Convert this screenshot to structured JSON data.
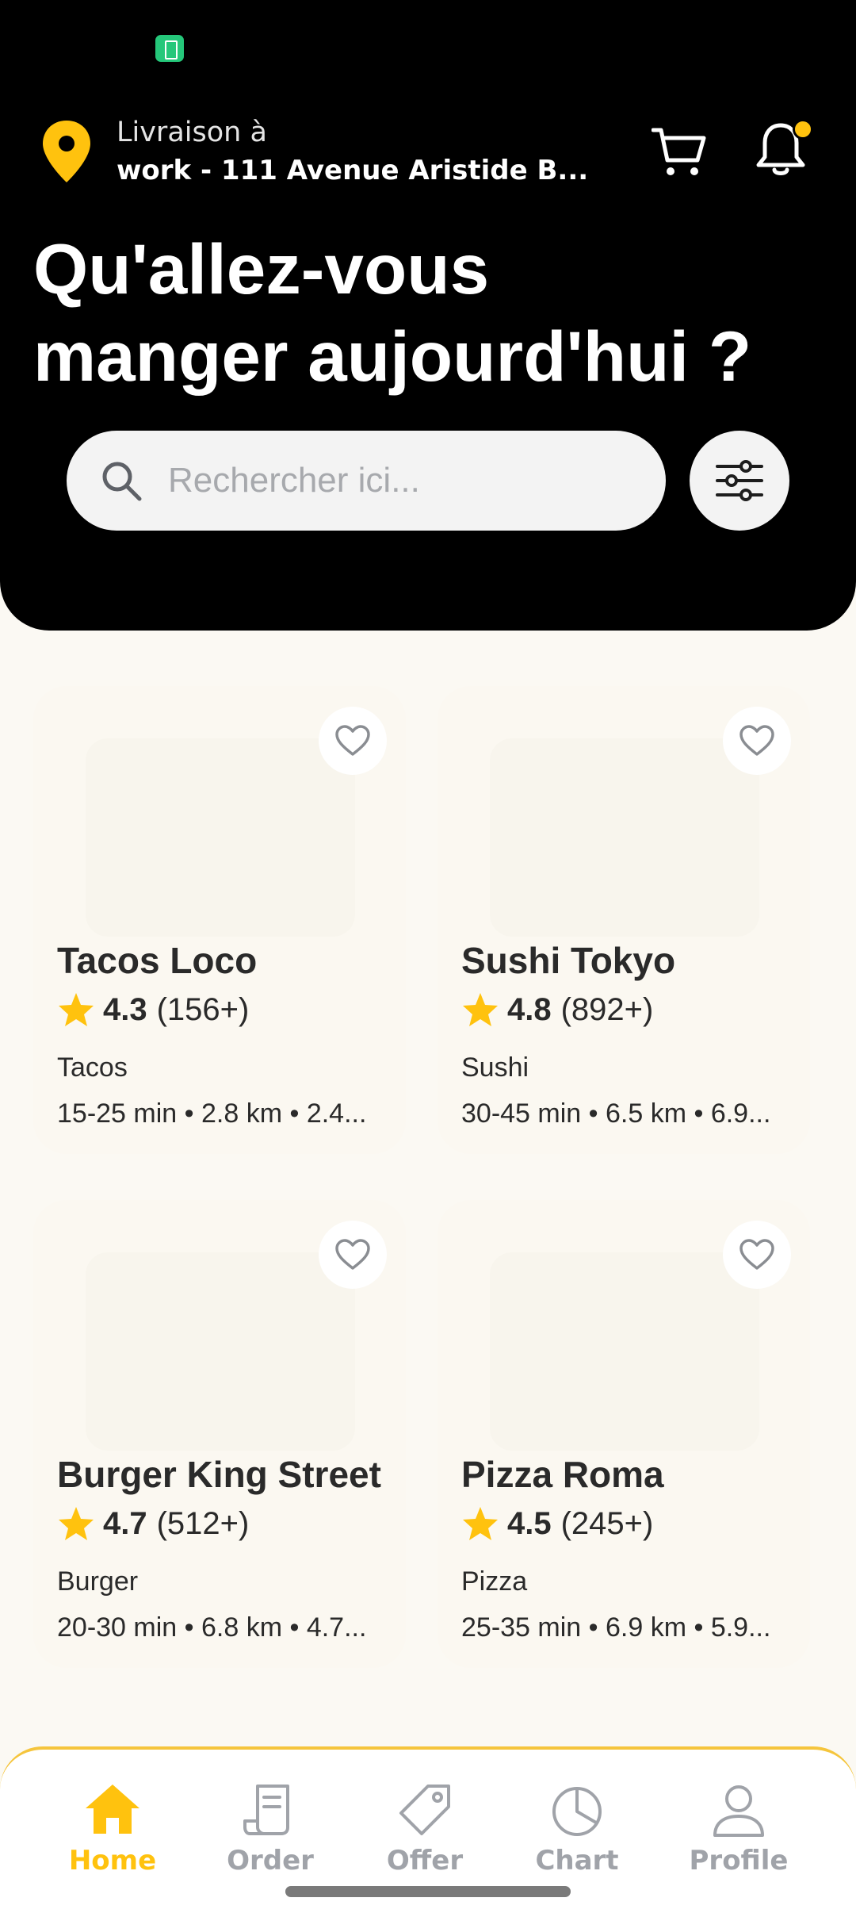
{
  "status_bar": {
    "battery_icon": "battery-charging-icon"
  },
  "header": {
    "delivery_label": "Livraison à",
    "address": "work - 111 Avenue Aristide B...",
    "headline_line1": "Qu'allez-vous",
    "headline_line2": "manger aujourd'hui ?",
    "notification_dot_color": "#ffc20e"
  },
  "search": {
    "placeholder": "Rechercher ici..."
  },
  "restaurants": [
    {
      "name": "Tacos Loco",
      "rating": "4.3",
      "reviews": "(156+)",
      "category": "Tacos",
      "meta": "15-25 min • 2.8 km • 2.4..."
    },
    {
      "name": "Sushi Tokyo",
      "rating": "4.8",
      "reviews": "(892+)",
      "category": "Sushi",
      "meta": "30-45 min • 6.5 km • 6.9..."
    },
    {
      "name": "Burger King Street",
      "rating": "4.7",
      "reviews": "(512+)",
      "category": "Burger",
      "meta": "20-30 min • 6.8 km • 4.7..."
    },
    {
      "name": "Pizza Roma",
      "rating": "4.5",
      "reviews": "(245+)",
      "category": "Pizza",
      "meta": "25-35 min • 6.9 km • 5.9..."
    }
  ],
  "nav": {
    "items": [
      {
        "label": "Home",
        "icon": "home-icon",
        "active": true
      },
      {
        "label": "Order",
        "icon": "receipt-icon",
        "active": false
      },
      {
        "label": "Offer",
        "icon": "tag-icon",
        "active": false
      },
      {
        "label": "Chart",
        "icon": "pie-chart-icon",
        "active": false
      },
      {
        "label": "Profile",
        "icon": "person-icon",
        "active": false
      }
    ]
  },
  "colors": {
    "accent": "#ffc20e",
    "header_bg": "#000000",
    "page_bg": "#fbf9f3",
    "inactive_nav": "#a0a3a9"
  }
}
